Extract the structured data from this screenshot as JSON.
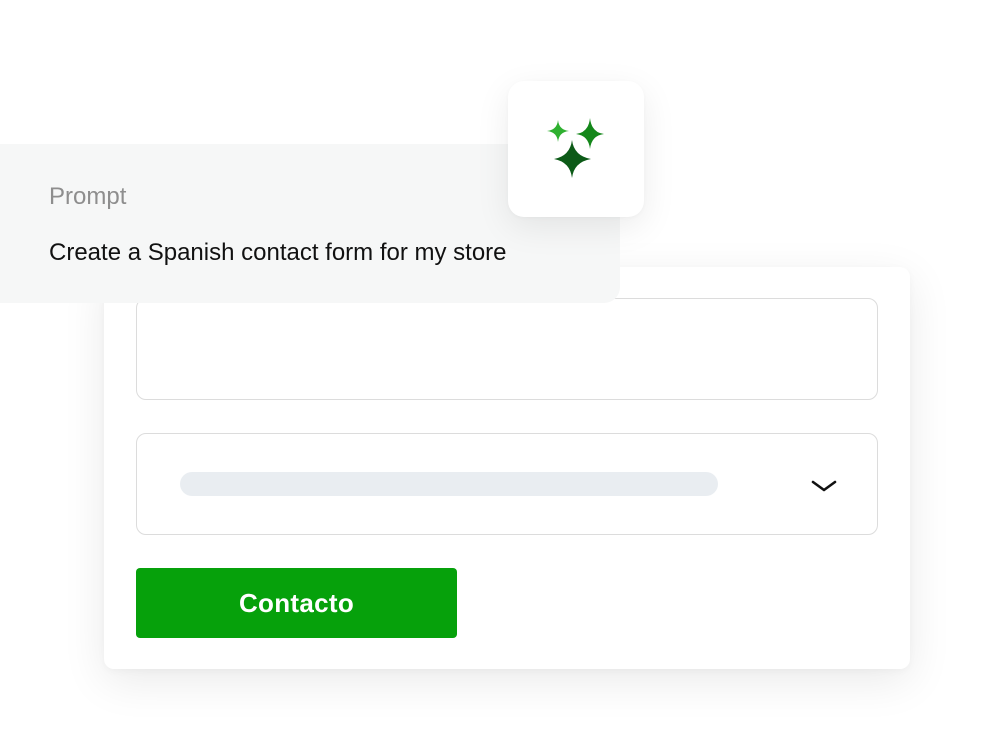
{
  "prompt": {
    "label": "Prompt",
    "text": "Create a Spanish contact form for my store"
  },
  "ai_tile": {
    "icon": "sparkles-icon",
    "colors": [
      "#2fb030",
      "#14871a",
      "#0c5a17"
    ]
  },
  "form": {
    "text_field_value": "",
    "select_value": "",
    "select_icon": "chevron-down-icon",
    "submit_label": "Contacto"
  },
  "colors": {
    "button": "#06a10b",
    "field_border": "#dcdcdc",
    "placeholder_bar": "#e9edf1",
    "prompt_background": "#f6f7f7"
  }
}
